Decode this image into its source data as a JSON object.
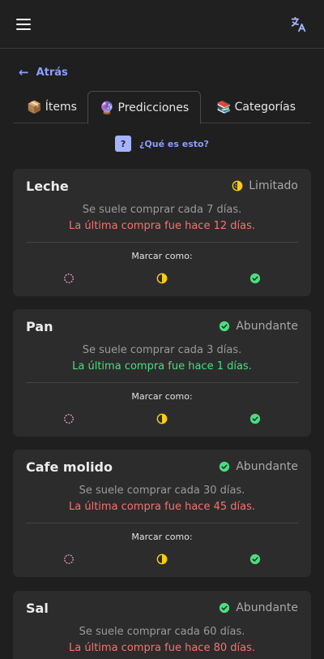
{
  "header": {
    "menu_icon": "hamburger-icon",
    "translate_icon": "translate-icon"
  },
  "back": {
    "label": "Atrás"
  },
  "tabs": [
    {
      "emoji": "📦",
      "label": "Ítems"
    },
    {
      "emoji": "🔮",
      "label": "Predicciones"
    },
    {
      "emoji": "📚",
      "label": "Categorías"
    }
  ],
  "help": {
    "badge": "?",
    "label": "¿Qué es esto?"
  },
  "items": [
    {
      "name": "Leche",
      "status": "Limitado",
      "frequency": "Se suele comprar cada 7 días.",
      "last_purchase": "La última compra fue hace 12 días.",
      "mark_label": "Marcar como:"
    },
    {
      "name": "Pan",
      "status": "Abundante",
      "frequency": "Se suele comprar cada 3 días.",
      "last_purchase": "La última compra fue hace 1 días.",
      "mark_label": "Marcar como:"
    },
    {
      "name": "Cafe molido",
      "status": "Abundante",
      "frequency": "Se suele comprar cada 30 días.",
      "last_purchase": "La última compra fue hace 45 días.",
      "mark_label": "Marcar como:"
    },
    {
      "name": "Sal",
      "status": "Abundante",
      "frequency": "Se suele comprar cada 60 días.",
      "last_purchase": "La última compra fue hace 80 días.",
      "mark_label": "Marcar como:"
    }
  ],
  "colors": {
    "accent": "#8b9dff",
    "overdue": "#f87171",
    "ok": "#4ade80",
    "limited": "#facc15",
    "empty": "#f9a8d4"
  }
}
